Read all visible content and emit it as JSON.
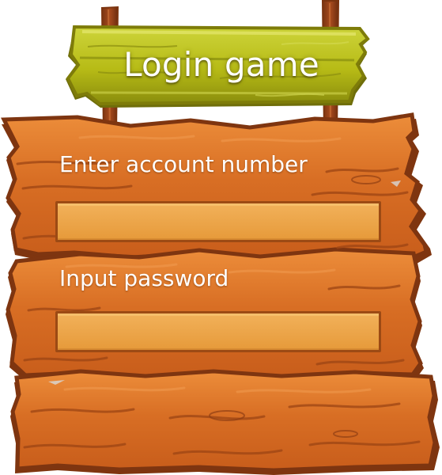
{
  "title": "Login game",
  "account": {
    "label": "Enter account number",
    "value": "",
    "placeholder": ""
  },
  "password": {
    "label": "Input password",
    "value": "",
    "placeholder": ""
  },
  "colors": {
    "title_sign": "#b8bd18",
    "wood": "#d96d24",
    "wood_light": "#e78a3d",
    "wood_dark": "#8a3c10",
    "field_fill": "#efa54a",
    "field_border": "#9c4a14",
    "text": "#ffffff"
  },
  "icons": {
    "sign_posts": "wood-post-icon",
    "grain": "wood-grain"
  }
}
